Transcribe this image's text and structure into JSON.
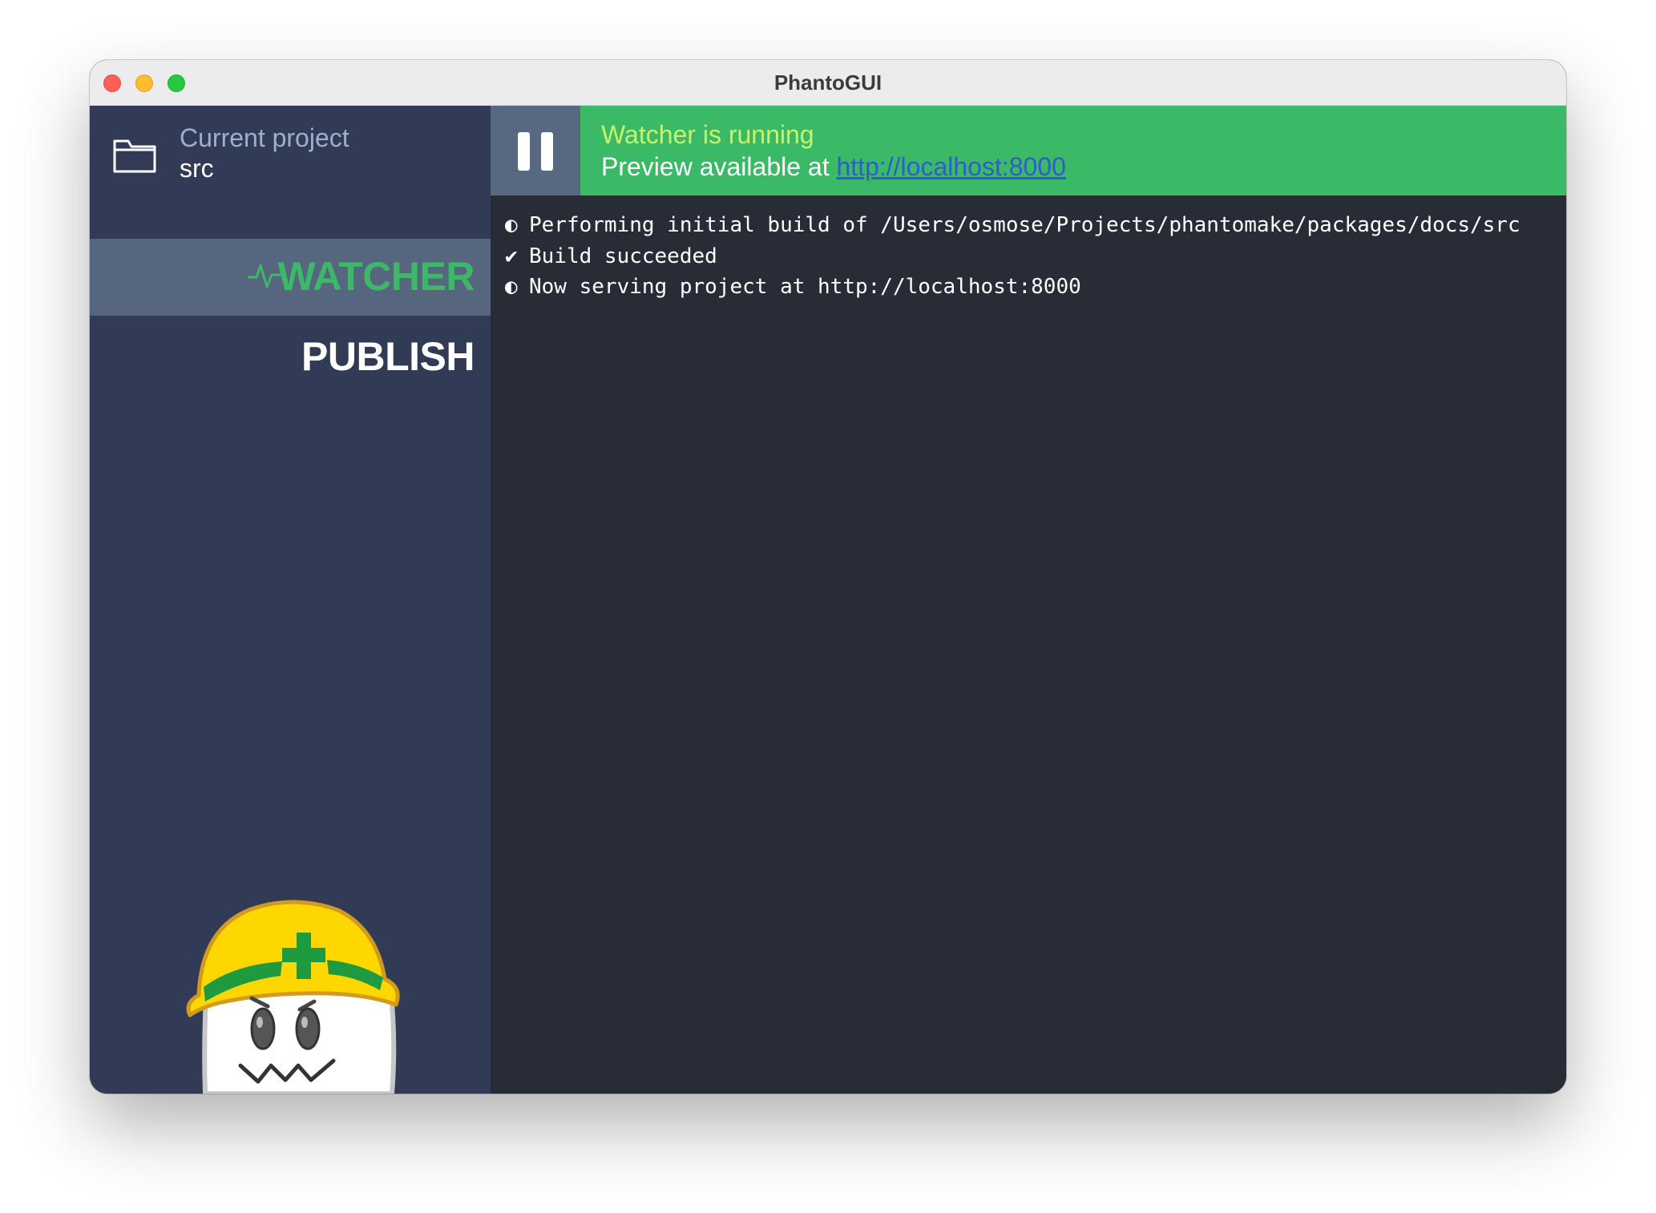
{
  "window": {
    "title": "PhantoGUI"
  },
  "sidebar": {
    "project_label": "Current project",
    "project_name": "src",
    "folder_icon": "folder-icon",
    "nav": [
      {
        "label": "WATCHER",
        "icon": "pulse-icon",
        "active": true,
        "color": "#3cb868"
      },
      {
        "label": "PUBLISH",
        "active": false
      }
    ],
    "mascot": "ghost-with-hard-hat"
  },
  "status": {
    "line1": "Watcher is running",
    "line2_prefix": "Preview available at ",
    "link": "http://localhost:8000",
    "pause_icon": "pause-icon",
    "bar_color": "#3ab966",
    "line1_color": "#c5f36e"
  },
  "log": [
    {
      "icon": "◐",
      "text": "Performing initial build of /Users/osmose/Projects/phantomake/packages/docs/src"
    },
    {
      "icon": "✔",
      "text": "Build succeeded"
    },
    {
      "icon": "◐",
      "text": "Now serving project at http://localhost:8000"
    }
  ]
}
